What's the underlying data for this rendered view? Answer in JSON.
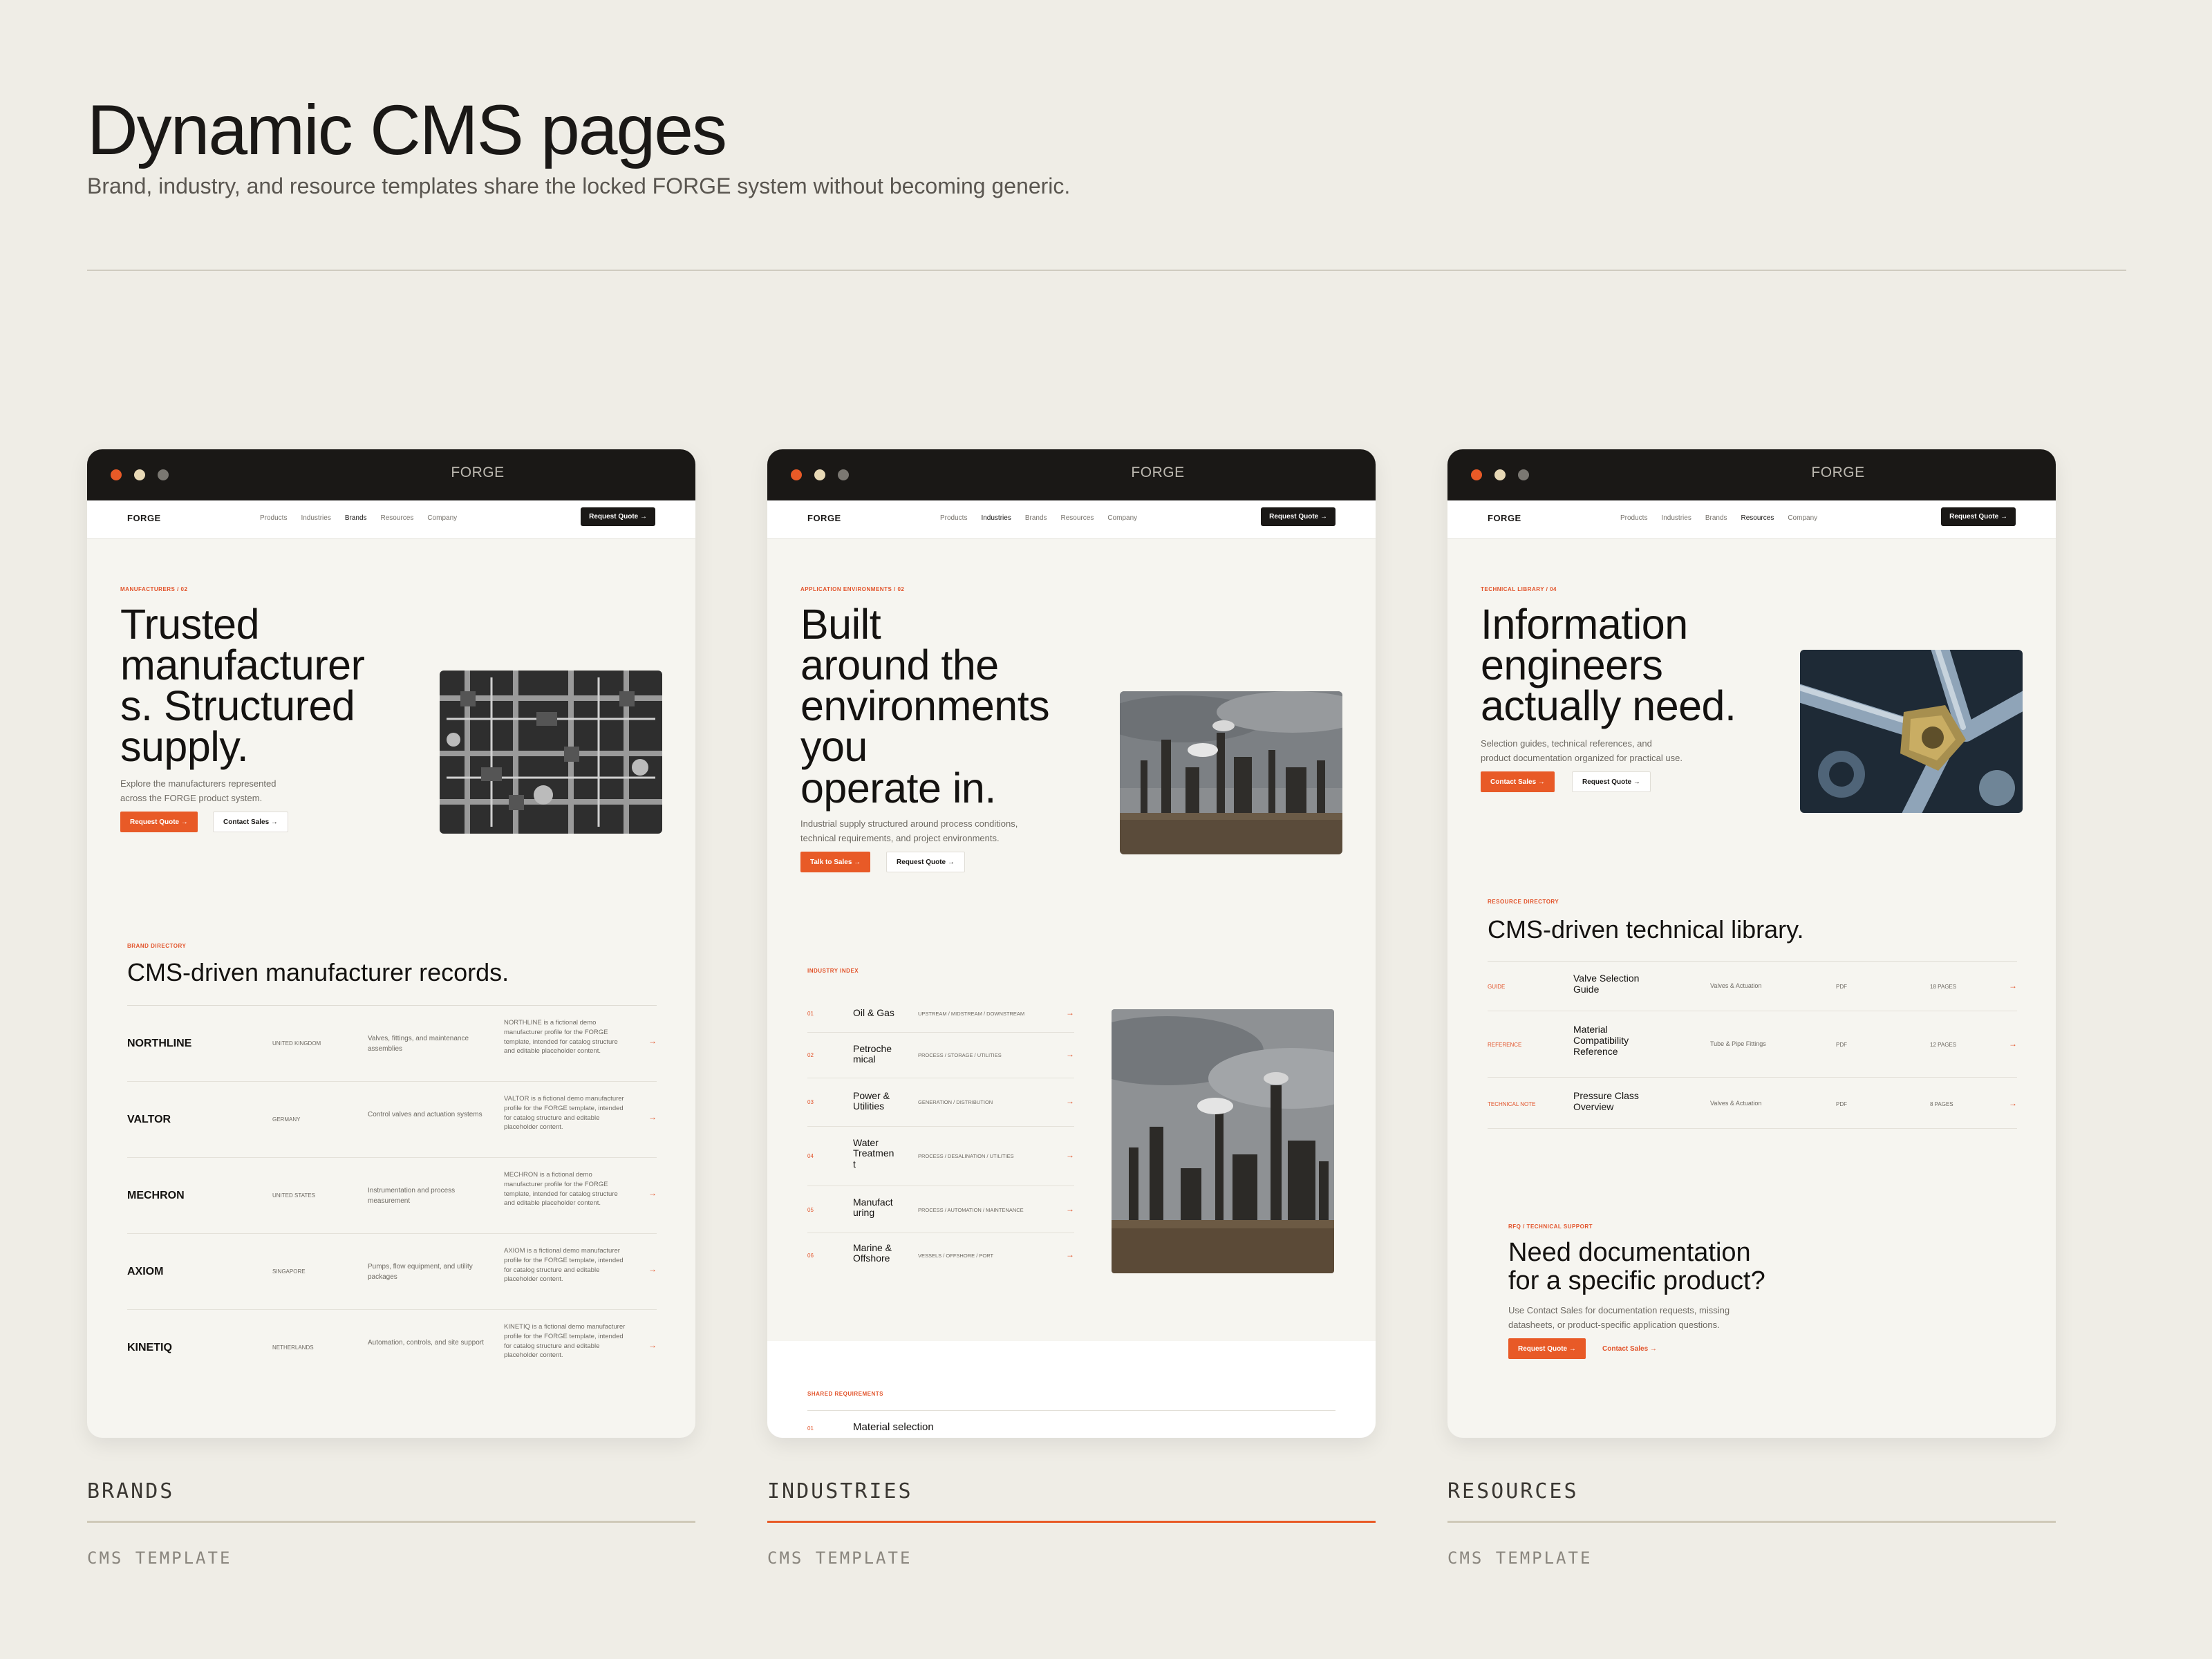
{
  "page": {
    "title": "Dynamic CMS pages",
    "subtitle": "Brand, industry, and resource templates share the locked FORGE system without becoming generic."
  },
  "colors": {
    "accent": "#e85a27",
    "dark": "#1a1816",
    "background": "#efede6"
  },
  "nav": {
    "logo": "FORGE",
    "links": [
      "Products",
      "Industries",
      "Brands",
      "Resources",
      "Company"
    ],
    "cta": "Request Quote →"
  },
  "brands": {
    "window_title": "FORGE",
    "eyebrow": "MANUFACTURERS / 02",
    "hero_lines": [
      "Trusted",
      "manufacturer",
      "s. Structured",
      "supply."
    ],
    "hero_text": [
      "Explore the manufacturers represented",
      "across the FORGE product system."
    ],
    "btn_primary": "Request Quote →",
    "btn_secondary": "Contact Sales →",
    "directory_eyebrow": "BRAND DIRECTORY",
    "directory_title": "CMS-driven manufacturer records.",
    "rows": [
      {
        "name": "NORTHLINE",
        "country": "UNITED KINGDOM",
        "desc": "Valves, fittings, and maintenance assemblies",
        "note": "NORTHLINE is a fictional demo manufacturer profile for the FORGE template, intended for catalog structure and editable placeholder content."
      },
      {
        "name": "VALTOR",
        "country": "GERMANY",
        "desc": "Control valves and actuation systems",
        "note": "VALTOR is a fictional demo manufacturer profile for the FORGE template, intended for catalog structure and editable placeholder content."
      },
      {
        "name": "MECHRON",
        "country": "UNITED STATES",
        "desc": "Instrumentation and process measurement",
        "note": "MECHRON is a fictional demo manufacturer profile for the FORGE template, intended for catalog structure and editable placeholder content."
      },
      {
        "name": "AXIOM",
        "country": "SINGAPORE",
        "desc": "Pumps, flow equipment, and utility packages",
        "note": "AXIOM is a fictional demo manufacturer profile for the FORGE template, intended for catalog structure and editable placeholder content."
      },
      {
        "name": "KINETIQ",
        "country": "NETHERLANDS",
        "desc": "Automation, controls, and site support",
        "note": "KINETIQ is a fictional demo manufacturer profile for the FORGE template, intended for catalog structure and editable placeholder content."
      }
    ],
    "label": "BRANDS",
    "sublabel": "CMS TEMPLATE"
  },
  "industries": {
    "window_title": "FORGE",
    "eyebrow": "APPLICATION ENVIRONMENTS / 02",
    "hero_lines": [
      "Built",
      "around the",
      "environments",
      "you",
      "operate in."
    ],
    "hero_text": [
      "Industrial supply structured around process conditions,",
      "technical requirements, and project environments."
    ],
    "btn_primary": "Talk to Sales →",
    "btn_secondary": "Request Quote →",
    "index_eyebrow": "INDUSTRY INDEX",
    "rows": [
      {
        "num": "01",
        "name": [
          "Oil & Gas"
        ],
        "tags": "UPSTREAM / MIDSTREAM / DOWNSTREAM"
      },
      {
        "num": "02",
        "name": [
          "Petroche",
          "mical"
        ],
        "tags": "PROCESS / STORAGE / UTILITIES"
      },
      {
        "num": "03",
        "name": [
          "Power &",
          "Utilities"
        ],
        "tags": "GENERATION / DISTRIBUTION"
      },
      {
        "num": "04",
        "name": [
          "Water",
          "Treatmen",
          "t"
        ],
        "tags": "PROCESS / DESALINATION / UTILITIES"
      },
      {
        "num": "05",
        "name": [
          "Manufact",
          "uring"
        ],
        "tags": "PROCESS / AUTOMATION / MAINTENANCE"
      },
      {
        "num": "06",
        "name": [
          "Marine &",
          "Offshore"
        ],
        "tags": "VESSELS / OFFSHORE / PORT"
      }
    ],
    "shared_eyebrow": "SHARED REQUIREMENTS",
    "shared_first": {
      "num": "01",
      "name": "Material selection"
    },
    "label": "INDUSTRIES",
    "sublabel": "CMS TEMPLATE"
  },
  "resources": {
    "window_title": "FORGE",
    "eyebrow": "TECHNICAL LIBRARY / 04",
    "hero_lines": [
      "Information",
      "engineers",
      "actually need."
    ],
    "hero_text": [
      "Selection guides, technical references, and",
      "product documentation organized for practical use."
    ],
    "btn_primary": "Contact Sales →",
    "btn_secondary": "Request Quote →",
    "directory_eyebrow": "RESOURCE DIRECTORY",
    "directory_title": "CMS-driven technical library.",
    "rows": [
      {
        "type": "GUIDE",
        "title": [
          "Valve Selection",
          "Guide"
        ],
        "category": "Valves & Actuation",
        "format": "PDF",
        "pages": "18 PAGES"
      },
      {
        "type": "REFERENCE",
        "title": [
          "Material",
          "Compatibility",
          "Reference"
        ],
        "category": "Tube & Pipe Fittings",
        "format": "PDF",
        "pages": "12 PAGES"
      },
      {
        "type": "TECHNICAL NOTE",
        "title": [
          "Pressure Class",
          "Overview"
        ],
        "category": "Valves & Actuation",
        "format": "PDF",
        "pages": "8 PAGES"
      }
    ],
    "cta_eyebrow": "RFQ / TECHNICAL SUPPORT",
    "cta_title": [
      "Need documentation",
      "for a specific product?"
    ],
    "cta_text": [
      "Use Contact Sales for documentation requests, missing",
      "datasheets, or product-specific application questions."
    ],
    "cta_primary": "Request Quote →",
    "cta_secondary": "Contact Sales →",
    "label": "RESOURCES",
    "sublabel": "CMS TEMPLATE"
  }
}
